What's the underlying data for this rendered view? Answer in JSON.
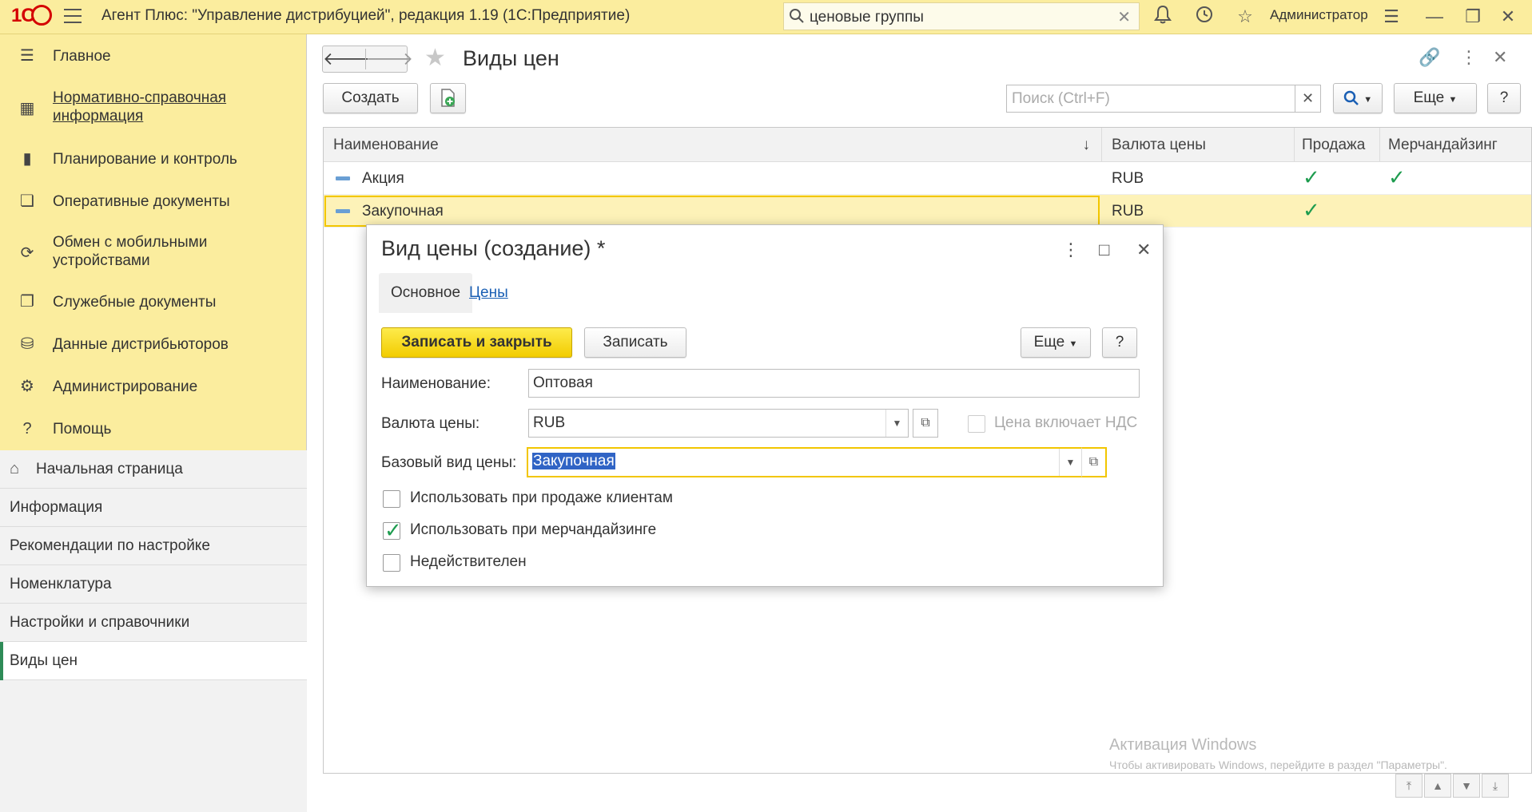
{
  "app": {
    "logo": "1С",
    "title": "Агент Плюс: \"Управление дистрибуцией\", редакция 1.19  (1С:Предприятие)",
    "global_search_value": "ценовые группы",
    "user": "Администратор"
  },
  "sidebar": {
    "items": [
      {
        "label": "Главное",
        "icon": "menu-lines-icon"
      },
      {
        "label": "Нормативно-справочная информация",
        "line1": "Нормативно-справочная",
        "line2": "информация",
        "icon": "catalog-icon"
      },
      {
        "label": "Планирование и контроль",
        "icon": "bar-chart-icon"
      },
      {
        "label": "Оперативные документы",
        "icon": "documents-icon"
      },
      {
        "label": "Обмен с мобильными устройствами",
        "line1": "Обмен с мобильными",
        "line2": "устройствами",
        "icon": "sync-icon"
      },
      {
        "label": "Служебные документы",
        "icon": "service-docs-icon"
      },
      {
        "label": "Данные дистрибьюторов",
        "icon": "distributor-data-icon"
      },
      {
        "label": "Администрирование",
        "icon": "gear-icon"
      },
      {
        "label": "Помощь",
        "icon": "help-icon"
      }
    ],
    "open_windows": [
      {
        "label": "Начальная страница"
      },
      {
        "label": "Информация"
      },
      {
        "label": "Рекомендации по настройке"
      },
      {
        "label": "Номенклатура"
      },
      {
        "label": "Настройки и справочники"
      },
      {
        "label": "Виды цен"
      }
    ]
  },
  "main": {
    "title": "Виды цен",
    "toolbar": {
      "create_label": "Создать",
      "search_placeholder": "Поиск (Ctrl+F)",
      "more_label": "Еще",
      "help_label": "?"
    },
    "table": {
      "columns": [
        "Наименование",
        "Валюта цены",
        "Продажа",
        "Мерчандайзинг"
      ],
      "sort_indicator": "↓",
      "rows": [
        {
          "name": "Акция",
          "currency": "RUB",
          "sale": true,
          "merch": true
        },
        {
          "name": "Закупочная",
          "currency": "RUB",
          "sale": true,
          "merch": false
        }
      ]
    }
  },
  "dialog": {
    "title": "Вид цены (создание) *",
    "tabs": [
      "Основное",
      "Цены"
    ],
    "save_close_label": "Записать и закрыть",
    "save_label": "Записать",
    "more_label": "Еще",
    "help_label": "?",
    "fields": {
      "name_label": "Наименование:",
      "name_value": "Оптовая",
      "currency_label": "Валюта цены:",
      "currency_value": "RUB",
      "vat_label": "Цена включает НДС",
      "base_label": "Базовый вид цены:",
      "base_value": "Закупочная"
    },
    "checkboxes": [
      {
        "label": "Использовать при продаже клиентам",
        "checked": false
      },
      {
        "label": "Использовать при мерчандайзинге",
        "checked": true
      },
      {
        "label": "Недействителен",
        "checked": false
      }
    ]
  },
  "watermark": {
    "line1": "Активация Windows",
    "line2": "Чтобы активировать Windows, перейдите в раздел \"Параметры\"."
  },
  "colors": {
    "topbar": "#fbed9e",
    "accent_yellow": "#f2cc00",
    "check_green": "#1e9c4f",
    "link_blue": "#1a5fb4"
  }
}
